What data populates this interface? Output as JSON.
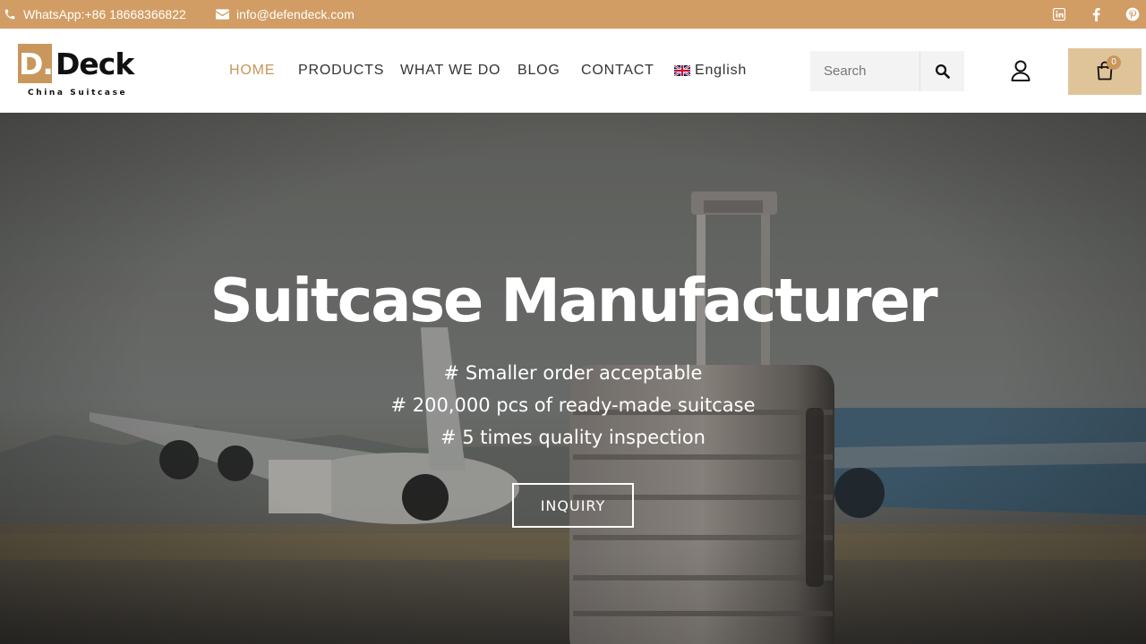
{
  "topbar": {
    "phone": "WhatsApp:+86 18668366822",
    "email": "info@defendeck.com",
    "social": [
      "linkedin-icon",
      "facebook-icon",
      "pinterest-icon"
    ]
  },
  "logo": {
    "mark": "D.",
    "word": "Deck",
    "tagline": "China Suitcase"
  },
  "nav": {
    "items": [
      "HOME",
      "PRODUCTS",
      "WHAT WE DO",
      "BLOG",
      "CONTACT"
    ],
    "active": "HOME",
    "language": "English"
  },
  "search": {
    "placeholder": "Search"
  },
  "cart": {
    "count": "0"
  },
  "hero": {
    "title": "Suitcase Manufacturer",
    "lines": [
      "# Smaller order acceptable",
      "# 200,000 pcs of ready-made suitcase",
      "# 5 times quality inspection"
    ],
    "button": "INQUIRY"
  },
  "colors": {
    "accent": "#d29d64",
    "cart_bg": "#dfc49a",
    "text_dark": "#333333"
  }
}
